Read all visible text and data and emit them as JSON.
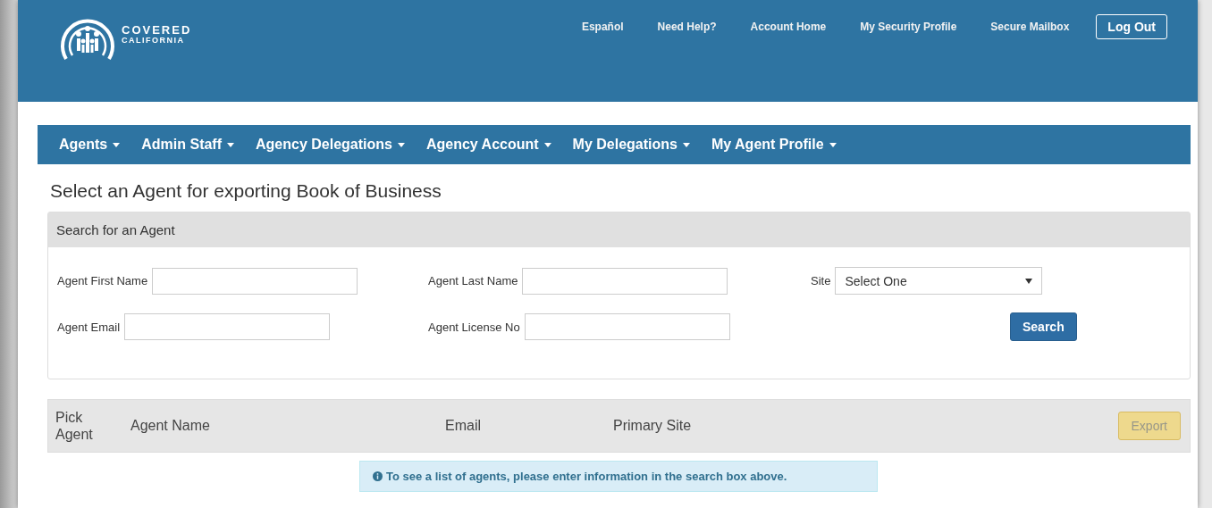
{
  "header": {
    "logo": {
      "line1": "COVERED",
      "line2": "CALIFORNIA"
    },
    "links": [
      "Español",
      "Need Help?",
      "Account Home",
      "My Security Profile",
      "Secure Mailbox"
    ],
    "logout": "Log Out"
  },
  "nav": [
    "Agents",
    "Admin Staff",
    "Agency Delegations",
    "Agency Account",
    "My Delegations",
    "My Agent Profile"
  ],
  "title": "Select an Agent for exporting Book of Business",
  "search_panel": {
    "heading": "Search for an Agent",
    "fields": [
      {
        "label": "Agent First Name",
        "kind": "text"
      },
      {
        "label": "Agent Last Name",
        "kind": "text"
      },
      {
        "label": "Site",
        "kind": "select",
        "value": "Select One"
      },
      {
        "label": "Agent Email",
        "kind": "text"
      },
      {
        "label": "Agent License No",
        "kind": "text"
      },
      {
        "label": "Search",
        "kind": "button"
      }
    ]
  },
  "table": {
    "columns": [
      "Pick Agent",
      "Agent Name",
      "Email",
      "Primary Site"
    ],
    "export_button": {
      "label": "Export",
      "disabled": true
    }
  },
  "info_message": "To see a list of agents, please enter information in the search box above."
}
